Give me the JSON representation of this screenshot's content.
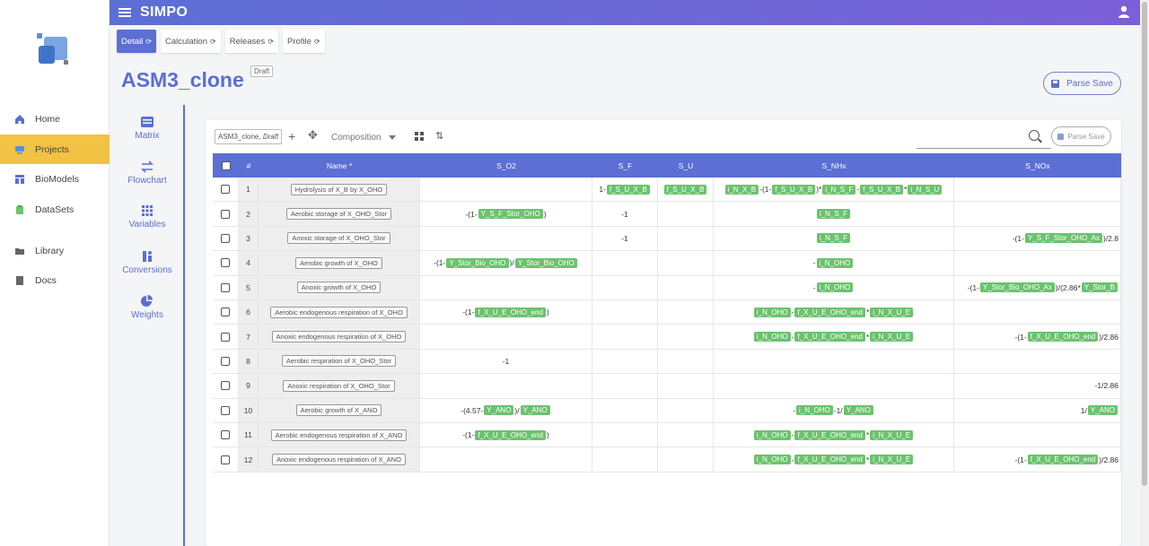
{
  "app": {
    "brand": "SIMPO"
  },
  "nav": [
    {
      "label": "Home",
      "icon": "home-icon"
    },
    {
      "label": "Projects",
      "icon": "projects-icon",
      "active": true
    },
    {
      "label": "BioModels",
      "icon": "biomodels-icon"
    },
    {
      "label": "DataSets",
      "icon": "datasets-icon"
    },
    {
      "label": "Library",
      "icon": "folder-icon"
    },
    {
      "label": "Docs",
      "icon": "docs-icon"
    }
  ],
  "tabs": [
    {
      "label": "Detail",
      "active": true
    },
    {
      "label": "Calculation"
    },
    {
      "label": "Releases"
    },
    {
      "label": "Profile"
    }
  ],
  "page": {
    "title": "ASM3_clone",
    "badge": "Draft",
    "parse_label": "Parse Save"
  },
  "subnav": [
    {
      "label": "Matrix",
      "icon": "matrix-icon"
    },
    {
      "label": "Flowchart",
      "icon": "flowchart-icon"
    },
    {
      "label": "Variables",
      "icon": "variables-icon"
    },
    {
      "label": "Conversions",
      "icon": "conversions-icon"
    },
    {
      "label": "Weights",
      "icon": "weights-icon"
    }
  ],
  "toolbar": {
    "chip_name": "ASM3_clone,",
    "chip_state": "Draft",
    "composition": "Composition",
    "parse_label": "Parse Save"
  },
  "table": {
    "headers": {
      "num": "#",
      "name": "Name *",
      "c1": "S_O2",
      "c2": "S_F",
      "c3": "S_U",
      "c4": "S_NHx",
      "c5": "S_NOx"
    },
    "rows": [
      {
        "n": "1",
        "name": "Hydrolysis of X_B by X_OHO",
        "c1": [],
        "c2": [
          [
            "t",
            "1-"
          ],
          [
            "g",
            "f_S_U_X_B"
          ]
        ],
        "c3": [
          [
            "g",
            "f_S_U_X_B"
          ]
        ],
        "c4": [
          [
            "g",
            "i_N_X_B"
          ],
          [
            "t",
            "-(1-"
          ],
          [
            "g",
            "f_S_U_X_B"
          ],
          [
            "t",
            ")*"
          ],
          [
            "g",
            "i_N_S_F"
          ],
          [
            "t",
            "-"
          ],
          [
            "g",
            "f_S_U_X_B"
          ],
          [
            "t",
            "*"
          ],
          [
            "g",
            "i_N_S_U"
          ]
        ],
        "c5": []
      },
      {
        "n": "2",
        "name": "Aerobic storage of X_OHO_Stor",
        "c1": [
          [
            "t",
            "-(1-"
          ],
          [
            "g",
            "Y_S_F_Stor_OHO"
          ],
          [
            "t",
            ")"
          ]
        ],
        "c2": [
          [
            "t",
            "-1"
          ]
        ],
        "c3": [],
        "c4": [
          [
            "g",
            "i_N_S_F"
          ]
        ],
        "c5": []
      },
      {
        "n": "3",
        "name": "Anoxic storage of X_OHO_Stor",
        "c1": [],
        "c2": [
          [
            "t",
            "-1"
          ]
        ],
        "c3": [],
        "c4": [
          [
            "g",
            "i_N_S_F"
          ]
        ],
        "c5": [
          [
            "t",
            "-(1-"
          ],
          [
            "g",
            "Y_S_F_Stor_OHO_Ax"
          ],
          [
            "t",
            ")/2.8"
          ]
        ]
      },
      {
        "n": "4",
        "name": "Aerobic growth of X_OHO",
        "c1": [
          [
            "t",
            "-(1-"
          ],
          [
            "g",
            "Y_Stor_Bio_OHO"
          ],
          [
            "t",
            ")/"
          ],
          [
            "g",
            "Y_Stor_Bio_OHO"
          ]
        ],
        "c2": [],
        "c3": [],
        "c4": [
          [
            "t",
            "-"
          ],
          [
            "g",
            "i_N_OHO"
          ]
        ],
        "c5": []
      },
      {
        "n": "5",
        "name": "Anoxic growth of X_OHO",
        "c1": [],
        "c2": [],
        "c3": [],
        "c4": [
          [
            "t",
            "-"
          ],
          [
            "g",
            "i_N_OHO"
          ]
        ],
        "c5": [
          [
            "t",
            "-(1-"
          ],
          [
            "g",
            "Y_Stor_Bio_OHO_Ax"
          ],
          [
            "t",
            ")/(2.86*"
          ],
          [
            "g",
            "Y_Stor_B"
          ]
        ]
      },
      {
        "n": "6",
        "name": "Aerobic endogenous respiration of X_OHO",
        "c1": [
          [
            "t",
            "-(1-"
          ],
          [
            "g",
            "f_X_U_E_OHO_end"
          ],
          [
            "t",
            ")"
          ]
        ],
        "c2": [],
        "c3": [],
        "c4": [
          [
            "g",
            "i_N_OHO"
          ],
          [
            "t",
            "-"
          ],
          [
            "g",
            "f_X_U_E_OHO_end"
          ],
          [
            "t",
            "*"
          ],
          [
            "g",
            "i_N_X_U_E"
          ]
        ],
        "c5": []
      },
      {
        "n": "7",
        "name": "Anoxic endogenous respiration of X_OHO",
        "c1": [],
        "c2": [],
        "c3": [],
        "c4": [
          [
            "g",
            "i_N_OHO"
          ],
          [
            "t",
            "-"
          ],
          [
            "g",
            "f_X_U_E_OHO_end"
          ],
          [
            "t",
            "*"
          ],
          [
            "g",
            "i_N_X_U_E"
          ]
        ],
        "c5": [
          [
            "t",
            "-(1-"
          ],
          [
            "g",
            "f_X_U_E_OHO_end"
          ],
          [
            "t",
            ")/2.86"
          ]
        ]
      },
      {
        "n": "8",
        "name": "Aerobic respiration of X_OHO_Stor",
        "c1": [
          [
            "t",
            "-1"
          ]
        ],
        "c2": [],
        "c3": [],
        "c4": [],
        "c5": []
      },
      {
        "n": "9",
        "name": "Anoxic respiration of X_OHO_Stor",
        "c1": [],
        "c2": [],
        "c3": [],
        "c4": [],
        "c5": [
          [
            "t",
            "-1/2.86"
          ]
        ]
      },
      {
        "n": "10",
        "name": "Aerobic growth of X_ANO",
        "c1": [
          [
            "t",
            "-(4.57-"
          ],
          [
            "g",
            "Y_ANO"
          ],
          [
            "t",
            ")/"
          ],
          [
            "g",
            "Y_ANO"
          ]
        ],
        "c2": [],
        "c3": [],
        "c4": [
          [
            "t",
            "-"
          ],
          [
            "g",
            "i_N_OHO"
          ],
          [
            "t",
            "-1/"
          ],
          [
            "g",
            "Y_ANO"
          ]
        ],
        "c5": [
          [
            "t",
            "1/"
          ],
          [
            "g",
            "Y_ANO"
          ]
        ]
      },
      {
        "n": "11",
        "name": "Aerobic endogenous respiration of X_ANO",
        "c1": [
          [
            "t",
            "-(1-"
          ],
          [
            "g",
            "f_X_U_E_OHO_end"
          ],
          [
            "t",
            ")"
          ]
        ],
        "c2": [],
        "c3": [],
        "c4": [
          [
            "g",
            "i_N_OHO"
          ],
          [
            "t",
            "-"
          ],
          [
            "g",
            "f_X_U_E_OHO_end"
          ],
          [
            "t",
            "*"
          ],
          [
            "g",
            "i_N_X_U_E"
          ]
        ],
        "c5": []
      },
      {
        "n": "12",
        "name": "Anoxic endogenous respiration of X_ANO",
        "c1": [],
        "c2": [],
        "c3": [],
        "c4": [
          [
            "g",
            "i_N_OHO"
          ],
          [
            "t",
            "-"
          ],
          [
            "g",
            "f_X_U_E_OHO_end"
          ],
          [
            "t",
            "*"
          ],
          [
            "g",
            "i_N_X_U_E"
          ]
        ],
        "c5": [
          [
            "t",
            "-(1-"
          ],
          [
            "g",
            "f_X_U_E_OHO_end"
          ],
          [
            "t",
            ")/2.86"
          ]
        ]
      }
    ]
  },
  "colors": {
    "accent": "#5b6fd4",
    "active_nav": "#f1c244",
    "tag": "#6cc26e"
  }
}
